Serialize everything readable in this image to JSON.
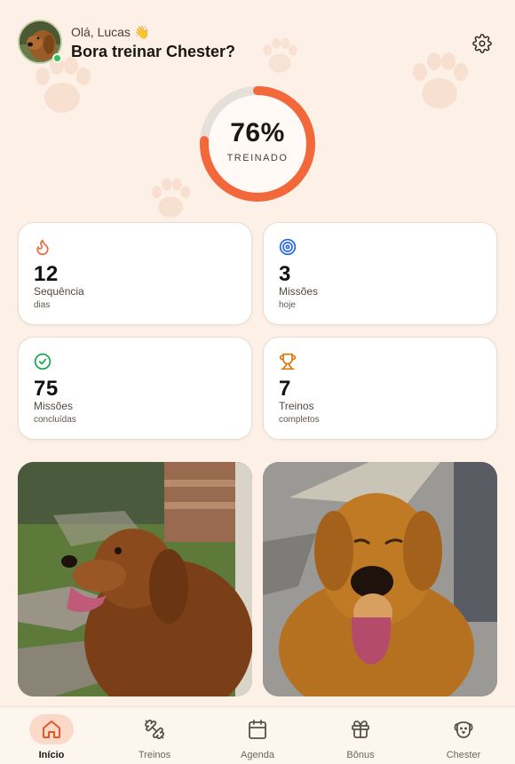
{
  "header": {
    "greeting": "Olá, Lucas",
    "wave_emoji": "👋",
    "title": "Bora treinar Chester?",
    "settings_icon": "gear-icon"
  },
  "progress": {
    "value_label": "76%",
    "value": 0.76,
    "caption": "TREINADO",
    "color": "#f2683b",
    "track_color": "#e6e0da"
  },
  "stats": [
    {
      "icon": "flame-icon",
      "value": "12",
      "label": "Sequência",
      "sub": "dias",
      "color": "#f2683b"
    },
    {
      "icon": "target-icon",
      "value": "3",
      "label": "Missões",
      "sub": "hoje",
      "color": "#2563eb"
    },
    {
      "icon": "check-circle-icon",
      "value": "75",
      "label": "Missões",
      "sub": "concluídas",
      "color": "#16a34a"
    },
    {
      "icon": "trophy-icon",
      "value": "7",
      "label": "Treinos",
      "sub": "completos",
      "color": "#d97706"
    }
  ],
  "photos": [
    {
      "name": "dog-photo-profile"
    },
    {
      "name": "dog-photo-front"
    }
  ],
  "nav": {
    "items": [
      {
        "label": "Início",
        "icon": "home-icon",
        "active": true
      },
      {
        "label": "Treinos",
        "icon": "dumbbell-icon",
        "active": false
      },
      {
        "label": "Agenda",
        "icon": "calendar-icon",
        "active": false
      },
      {
        "label": "Bônus",
        "icon": "gift-icon",
        "active": false
      },
      {
        "label": "Chester",
        "icon": "dog-face-icon",
        "active": false
      }
    ],
    "active_color": "#e2582a"
  }
}
